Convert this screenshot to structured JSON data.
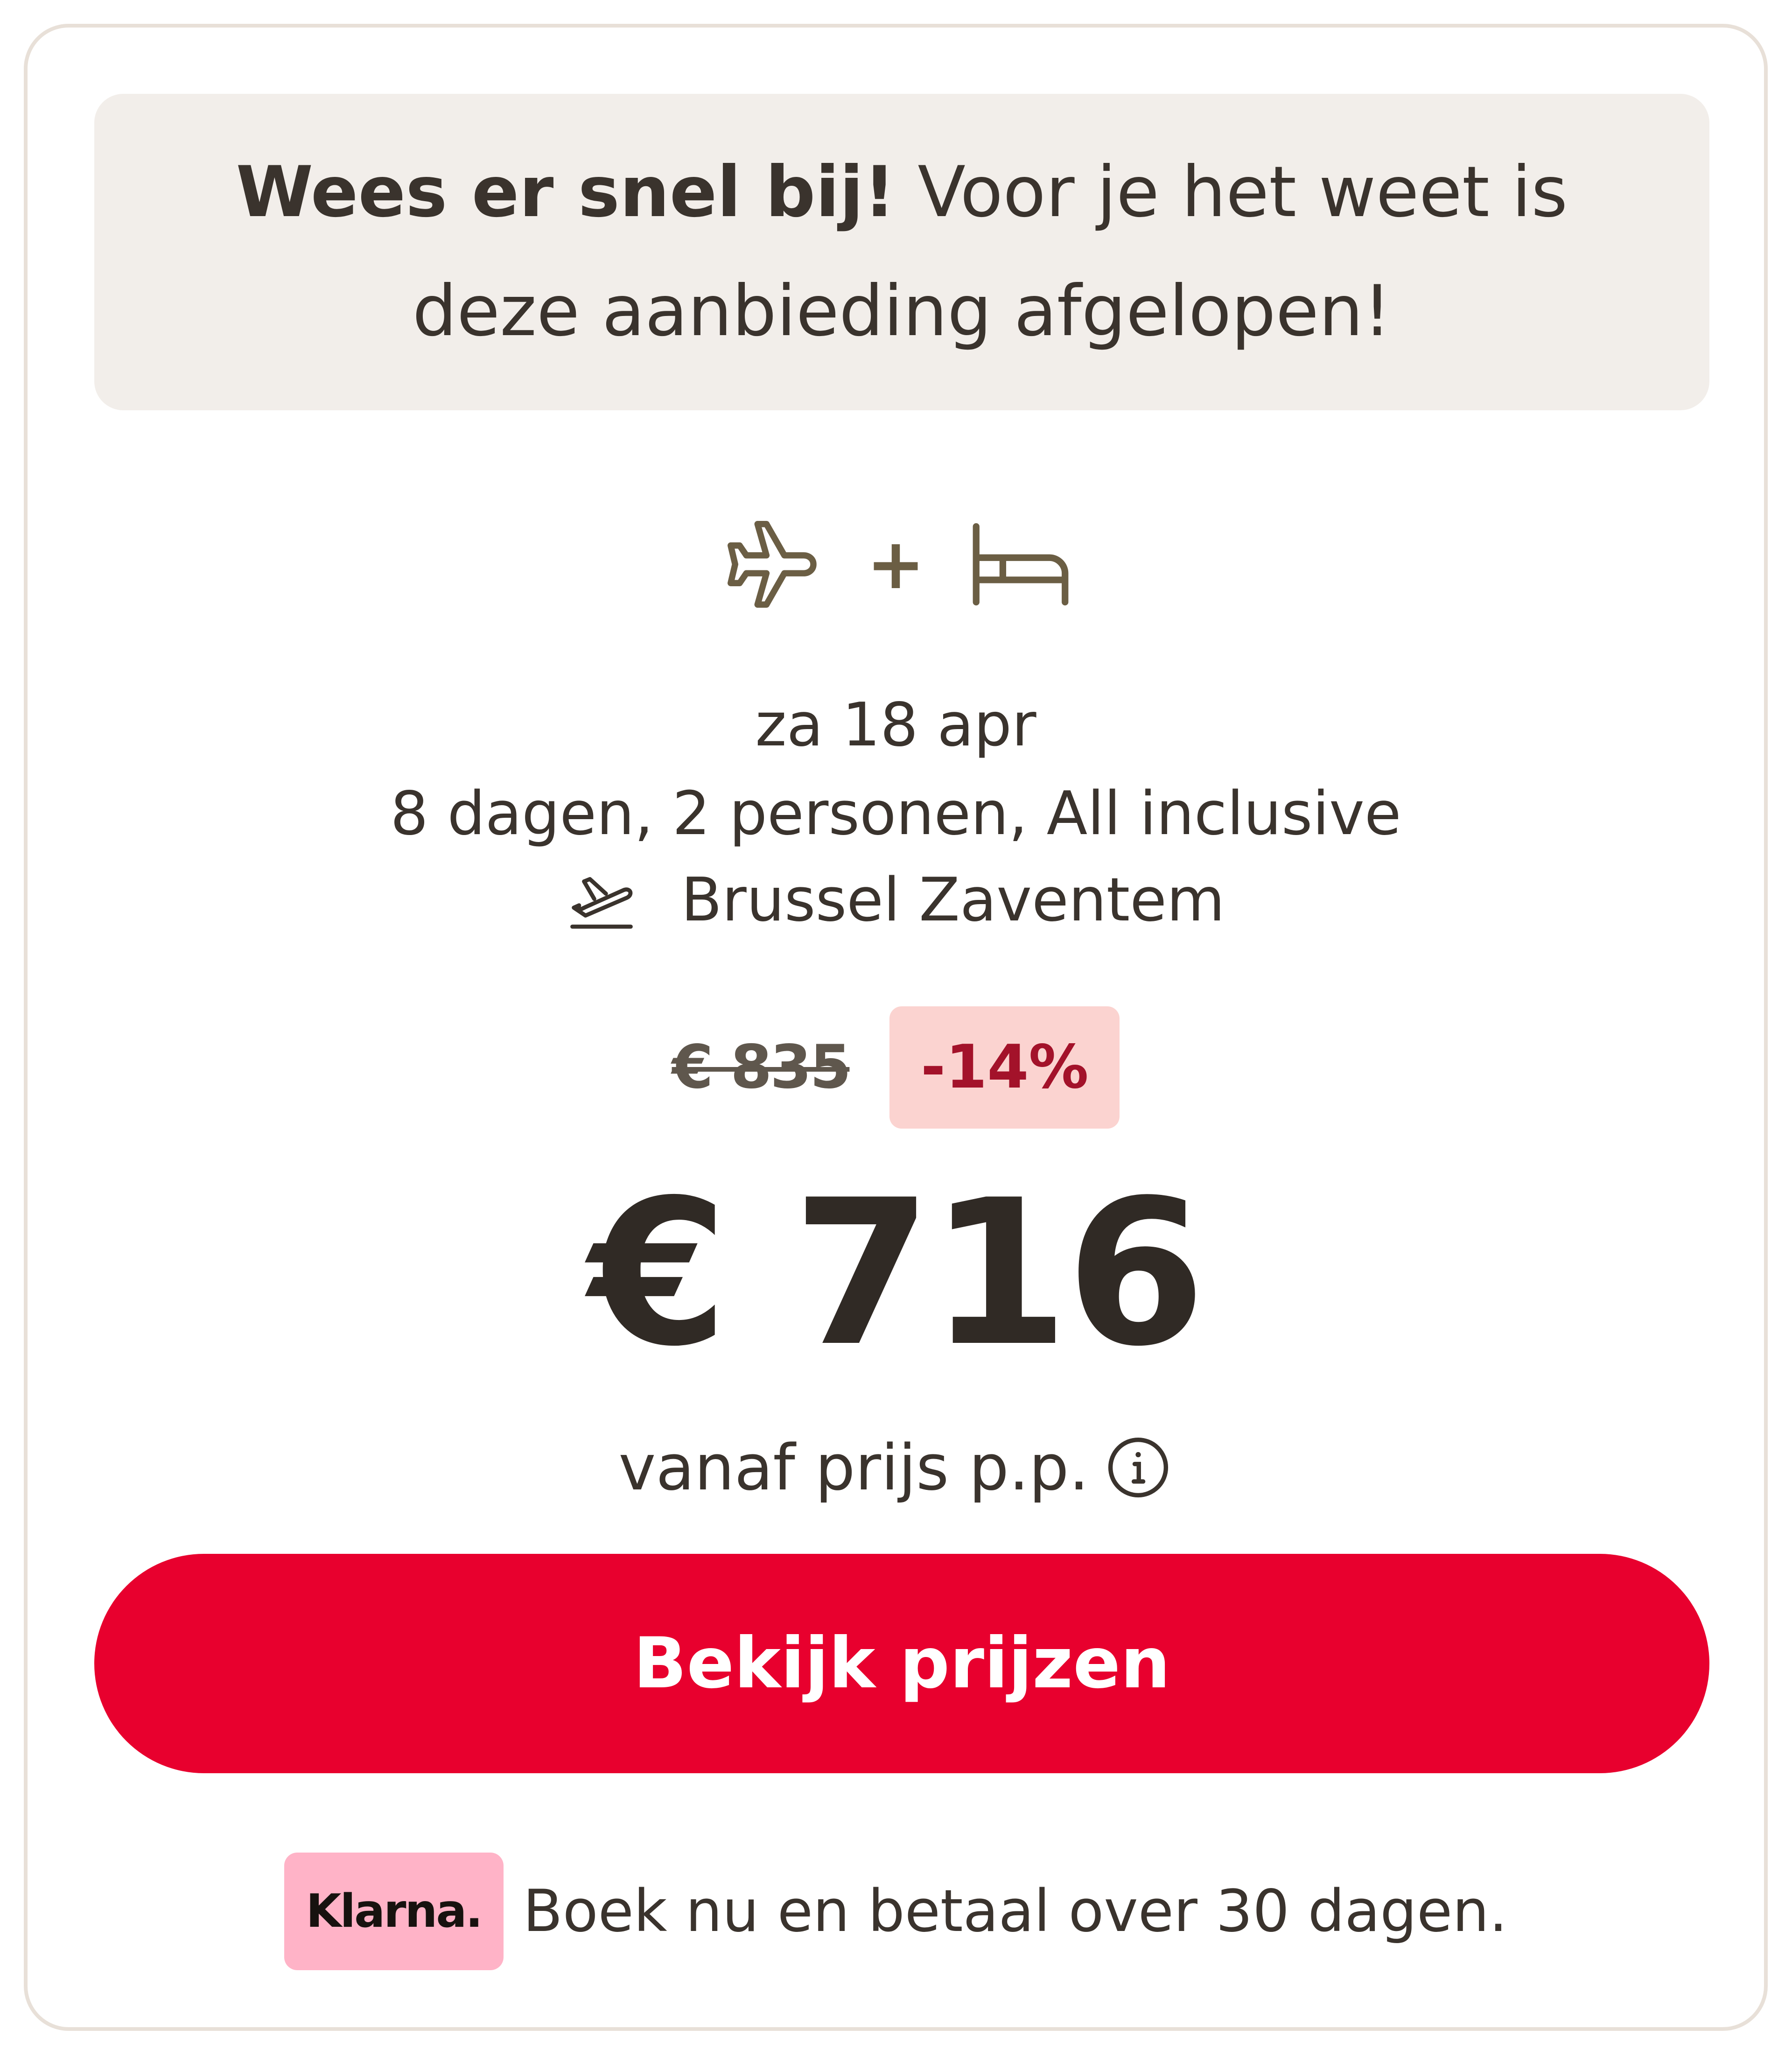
{
  "urgency": {
    "bold": "Wees er snel bij!",
    "text": "Voor je het weet is deze aanbieding afgelopen!"
  },
  "package": {
    "icons": [
      "plane-icon",
      "bed-icon"
    ],
    "plus": "+"
  },
  "trip": {
    "date": "za 18 apr",
    "details": "8 dagen, 2 personen, All inclusive",
    "airport": "Brussel Zaventem"
  },
  "pricing": {
    "old_price": "€ 835",
    "discount": "-14%",
    "price": "€ 716",
    "note": "vanaf prijs p.p."
  },
  "cta": {
    "label": "Bekijk prijzen"
  },
  "klarna": {
    "logo": "Klarna.",
    "text": "Boek nu en betaal over 30 dagen."
  },
  "colors": {
    "accent": "#e8002e",
    "badge_bg": "#fbd3d0",
    "badge_text": "#a3122a",
    "klarna_pink": "#ffb3c7",
    "banner_bg": "#f2eeea"
  }
}
